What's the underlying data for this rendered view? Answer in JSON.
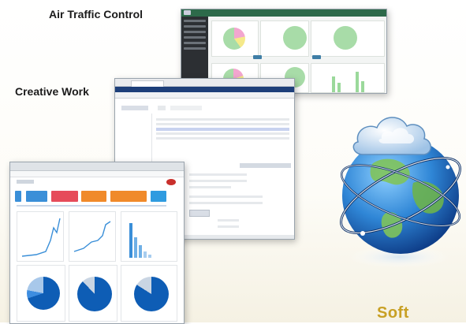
{
  "labels": {
    "air_traffic": "Air Traffic Control",
    "creative_work": "Creative Work",
    "footer_partial": "Soft"
  },
  "colors": {
    "atc_header": "#2d6a4a",
    "cw_header": "#1d3f7a",
    "dash_tiles": [
      "#3a8fd8",
      "#e64b5a",
      "#f08a2a",
      "#f08a2a",
      "#2f9be0"
    ],
    "pie_blue": "#0e5db5",
    "footer_gold": "#c8a024"
  },
  "icons": {
    "globe": "globe-with-cloud-icon"
  }
}
